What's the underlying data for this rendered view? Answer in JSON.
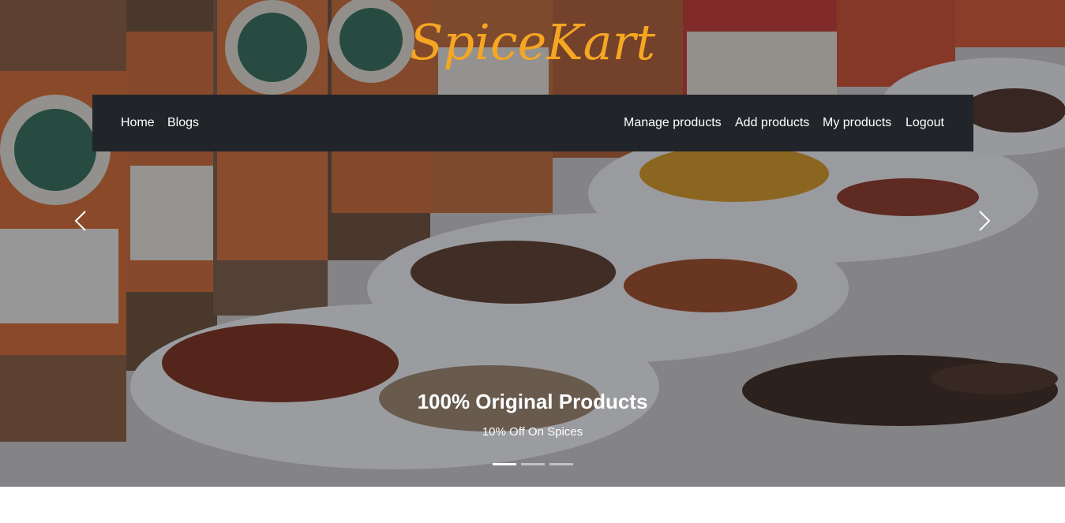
{
  "brand": {
    "name": "SpiceKart",
    "color": "#f5a623"
  },
  "nav": {
    "left": [
      {
        "label": "Home"
      },
      {
        "label": "Blogs"
      }
    ],
    "right": [
      {
        "label": "Manage products"
      },
      {
        "label": "Add products"
      },
      {
        "label": "My products"
      },
      {
        "label": "Logout"
      }
    ],
    "background": "#212529"
  },
  "carousel": {
    "slide": {
      "title": "100% Original Products",
      "subtitle": "10% Off On Spices",
      "image": "spice-jars-and-bowls-photo"
    },
    "prev_icon": "chevron-left-icon",
    "next_icon": "chevron-right-icon",
    "slide_count": 3,
    "active_index": 0
  }
}
